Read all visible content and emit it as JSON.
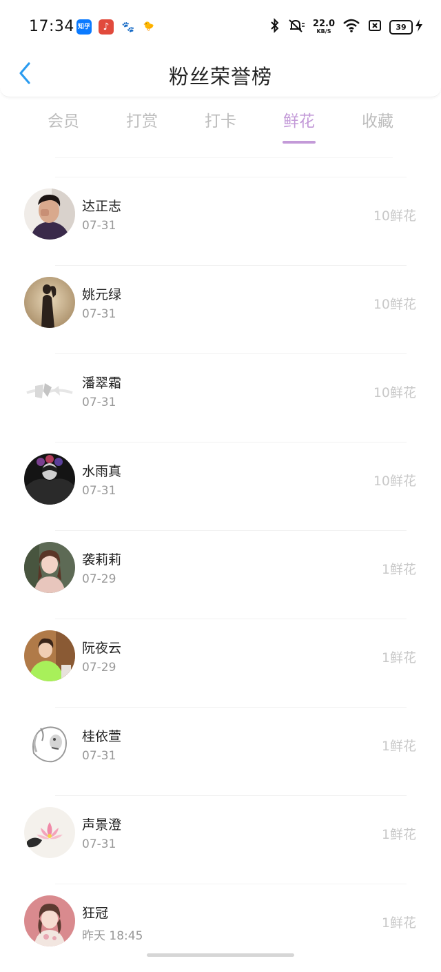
{
  "status_bar": {
    "time": "17:34",
    "app_icons": [
      {
        "name": "zhihu-app-icon",
        "label": "知乎"
      },
      {
        "name": "music-app-icon",
        "label": "♪"
      },
      {
        "name": "baidu-app-icon",
        "label": "🐾"
      },
      {
        "name": "bird-app-icon",
        "label": "🐤"
      }
    ],
    "net_speed": "22.0",
    "net_unit": "KB/S",
    "battery_level": "39"
  },
  "header": {
    "title": "粉丝荣誉榜",
    "accent_color": "#2b9cf0"
  },
  "tabs": [
    {
      "label": "会员",
      "active": false
    },
    {
      "label": "打赏",
      "active": false
    },
    {
      "label": "打卡",
      "active": false
    },
    {
      "label": "鲜花",
      "active": true
    },
    {
      "label": "收藏",
      "active": false
    }
  ],
  "active_tab_color": "#c39ad8",
  "fans": [
    {
      "name": "达正志",
      "date": "07-31",
      "amount": "10鲜花",
      "avatar": "man-dark-jacket"
    },
    {
      "name": "姚元绿",
      "date": "07-31",
      "amount": "10鲜花",
      "avatar": "silhouette-sepia"
    },
    {
      "name": "潘翠霜",
      "date": "07-31",
      "amount": "10鲜花",
      "avatar": "white-sketch"
    },
    {
      "name": "水雨真",
      "date": "07-31",
      "amount": "10鲜花",
      "avatar": "dark-flower-crown"
    },
    {
      "name": "袭莉莉",
      "date": "07-29",
      "amount": "1鲜花",
      "avatar": "girl-portrait"
    },
    {
      "name": "阮夜云",
      "date": "07-29",
      "amount": "1鲜花",
      "avatar": "girl-green-shirt"
    },
    {
      "name": "桂依萱",
      "date": "07-31",
      "amount": "1鲜花",
      "avatar": "lion-sketch"
    },
    {
      "name": "声景澄",
      "date": "07-31",
      "amount": "1鲜花",
      "avatar": "lotus-painting"
    },
    {
      "name": "狂冠",
      "date": "昨天 18:45",
      "amount": "1鲜花",
      "avatar": "girl-illustration-pink"
    }
  ]
}
